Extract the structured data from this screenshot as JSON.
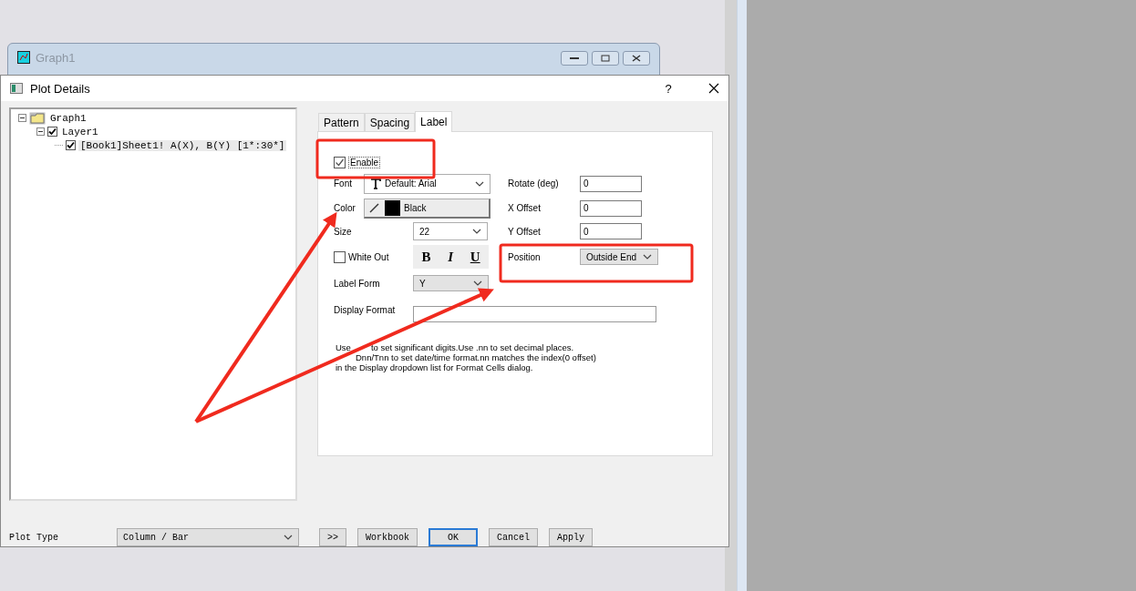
{
  "background_window": {
    "title": "Graph1"
  },
  "dialog": {
    "title": "Plot Details",
    "help": "?"
  },
  "tree": [
    {
      "kind": "folder",
      "label": "Graph1",
      "expanded": true,
      "selected": false,
      "children": [
        {
          "kind": "checkbox",
          "label": "Layer1",
          "checked": true,
          "expanded": true,
          "selected": false,
          "children": [
            {
              "kind": "checkbox",
              "label": "[Book1]Sheet1! A(X), B(Y) [1*:30*]",
              "checked": true,
              "selected": true
            }
          ]
        }
      ]
    }
  ],
  "tabs": [
    {
      "label": "Pattern",
      "selected": false
    },
    {
      "label": "Spacing",
      "selected": false
    },
    {
      "label": "Label",
      "selected": true
    }
  ],
  "label_tab": {
    "enable": {
      "label": "Enable",
      "checked": true
    },
    "font": {
      "label": "Font",
      "value": "Default: Arial"
    },
    "color": {
      "label": "Color",
      "value": "Black"
    },
    "size": {
      "label": "Size",
      "value": "22"
    },
    "white_out": {
      "label": "White Out",
      "checked": false
    },
    "style_buttons": [
      {
        "label": "B",
        "kind": "bold"
      },
      {
        "label": "I",
        "kind": "italic"
      },
      {
        "label": "U",
        "kind": "underline"
      }
    ],
    "label_form": {
      "label": "Label Form",
      "value": "Y"
    },
    "display_format": {
      "label": "Display Format"
    },
    "rotate": {
      "label": "Rotate (deg)",
      "value": "0"
    },
    "x_offset": {
      "label": "X Offset",
      "value": "0"
    },
    "y_offset": {
      "label": "Y Offset",
      "value": "0"
    },
    "position": {
      "label": "Position",
      "value": "Outside End"
    },
    "help_lines": [
      {
        "parts": [
          {
            "text": "Use"
          },
          {
            "text": "to set significant digits.Use .nn to set decimal places.",
            "gap_before": true
          }
        ]
      },
      {
        "parts": [
          {
            "text": "Dnn/Tnn to set date/time format.nn matches the index(0 offset)",
            "gap_before": true
          }
        ]
      },
      {
        "parts": [
          {
            "text": "in the Display dropdown list for Format Cells dialog."
          }
        ]
      }
    ]
  },
  "bottom": {
    "plot_type_label": "Plot Type",
    "plot_type": "Column / Bar",
    "buttons": [
      {
        "label": ">>",
        "default": false
      },
      {
        "label": "Workbook",
        "default": false
      },
      {
        "label": "OK",
        "default": true
      },
      {
        "label": "Cancel",
        "default": false
      },
      {
        "label": "Apply",
        "default": false
      }
    ]
  }
}
